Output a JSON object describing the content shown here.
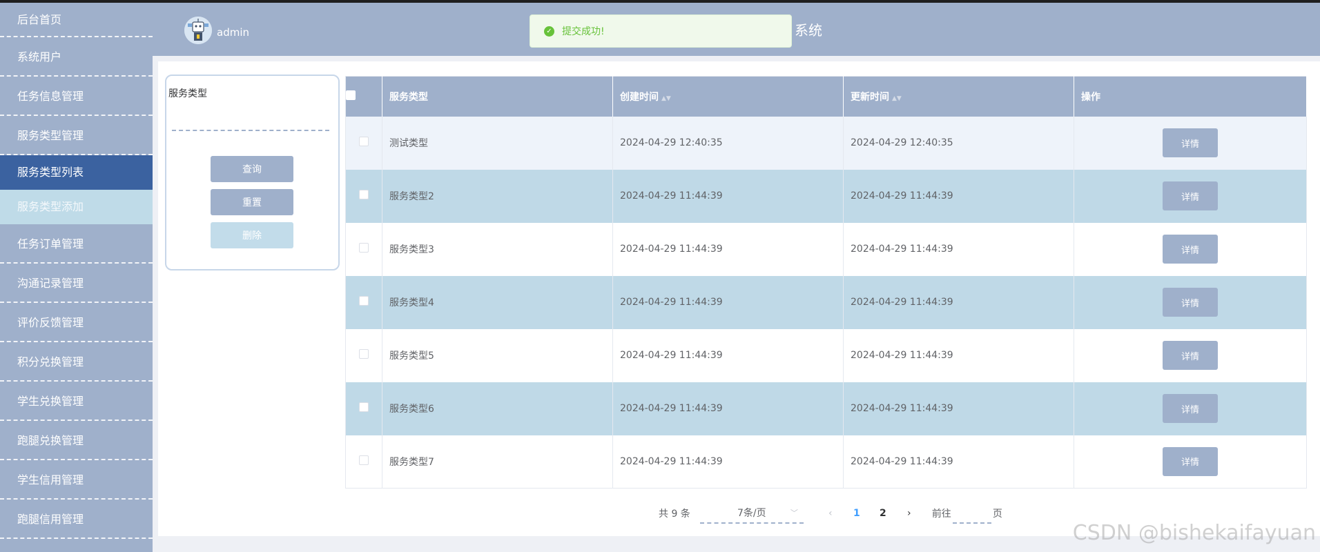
{
  "sidebar": {
    "items": [
      {
        "label": "后台首页"
      },
      {
        "label": "系统用户"
      },
      {
        "label": "任务信息管理"
      },
      {
        "label": "服务类型管理"
      },
      {
        "label": "服务类型列表"
      },
      {
        "label": "服务类型添加"
      },
      {
        "label": "任务订单管理"
      },
      {
        "label": "沟通记录管理"
      },
      {
        "label": "评价反馈管理"
      },
      {
        "label": "积分兑换管理"
      },
      {
        "label": "学生兑换管理"
      },
      {
        "label": "跑腿兑换管理"
      },
      {
        "label": "学生信用管理"
      },
      {
        "label": "跑腿信用管理"
      }
    ]
  },
  "header": {
    "username": "admin",
    "title_suffix": "系统"
  },
  "toast": {
    "message": "提交成功!"
  },
  "search": {
    "label": "服务类型",
    "value": "",
    "query_label": "查询",
    "reset_label": "重置",
    "delete_label": "删除"
  },
  "table": {
    "headers": {
      "service_type": "服务类型",
      "created": "创建时间",
      "updated": "更新时间",
      "ops": "操作"
    },
    "detail_label": "详情",
    "rows": [
      {
        "name": "测试类型",
        "created": "2024-04-29 12:40:35",
        "updated": "2024-04-29 12:40:35"
      },
      {
        "name": "服务类型2",
        "created": "2024-04-29 11:44:39",
        "updated": "2024-04-29 11:44:39"
      },
      {
        "name": "服务类型3",
        "created": "2024-04-29 11:44:39",
        "updated": "2024-04-29 11:44:39"
      },
      {
        "name": "服务类型4",
        "created": "2024-04-29 11:44:39",
        "updated": "2024-04-29 11:44:39"
      },
      {
        "name": "服务类型5",
        "created": "2024-04-29 11:44:39",
        "updated": "2024-04-29 11:44:39"
      },
      {
        "name": "服务类型6",
        "created": "2024-04-29 11:44:39",
        "updated": "2024-04-29 11:44:39"
      },
      {
        "name": "服务类型7",
        "created": "2024-04-29 11:44:39",
        "updated": "2024-04-29 11:44:39"
      }
    ]
  },
  "pagination": {
    "total": "共 9 条",
    "page_size": "7条/页",
    "pages": [
      "1",
      "2"
    ],
    "current": "1",
    "goto_prefix": "前往",
    "goto_suffix": "页"
  },
  "watermark": "CSDN @bishekaifayuan",
  "colors": {
    "primary": "#9fb0cb",
    "active_nav": "#3b62a0",
    "stripe": "#bfd9e7",
    "success": "#67c23a"
  }
}
